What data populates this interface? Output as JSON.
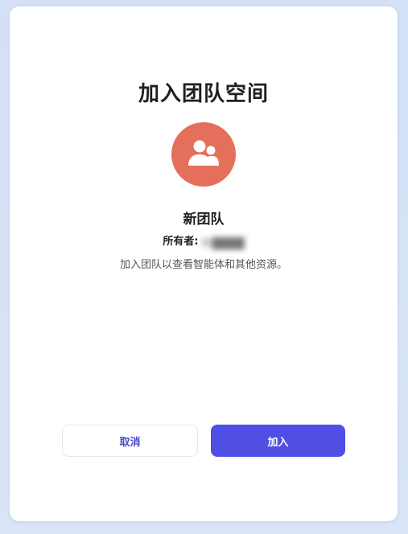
{
  "dialog": {
    "title": "加入团队空间",
    "avatar_icon": "team-users-icon",
    "avatar_color": "#e4705c",
    "team_name": "新团队",
    "owner_label": "所有者:",
    "owner_name": "阿████",
    "description": "加入团队以查看智能体和其他资源。",
    "cancel_label": "取消",
    "join_label": "加入",
    "accent_color": "#4f4fe6"
  }
}
